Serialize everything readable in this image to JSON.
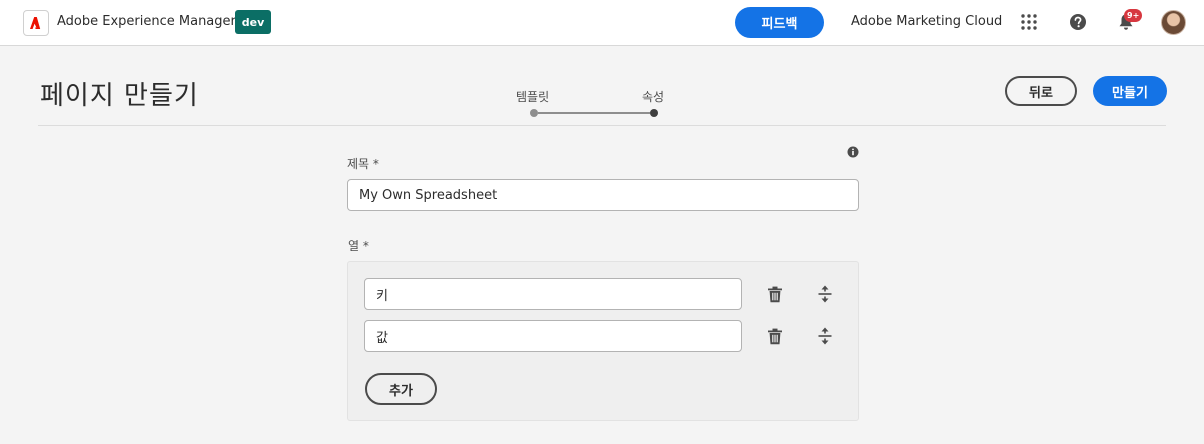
{
  "topbar": {
    "logo_icon": "adobe-logo-icon",
    "app_title": "Adobe Experience Manager",
    "env_badge": "dev",
    "feedback_label": "피드백",
    "cloud_label": "Adobe Marketing Cloud",
    "notification_count": "9+",
    "icons": [
      "apps-grid-icon",
      "help-icon",
      "bell-icon",
      "avatar"
    ]
  },
  "page": {
    "title": "페이지 만들기",
    "steps": [
      {
        "label": "템플릿",
        "state": "completed"
      },
      {
        "label": "속성",
        "state": "current"
      }
    ],
    "back_label": "뒤로",
    "create_label": "만들기"
  },
  "form": {
    "title_label": "제목 *",
    "title_value": "My Own Spreadsheet",
    "columns_label": "열 *",
    "columns": [
      {
        "value": "키"
      },
      {
        "value": "값"
      }
    ],
    "add_label": "추가"
  },
  "colors": {
    "accent": "#1473e6",
    "env_badge": "#0b6e65",
    "notification": "#d7373f",
    "adobe_red": "#eb1000"
  }
}
